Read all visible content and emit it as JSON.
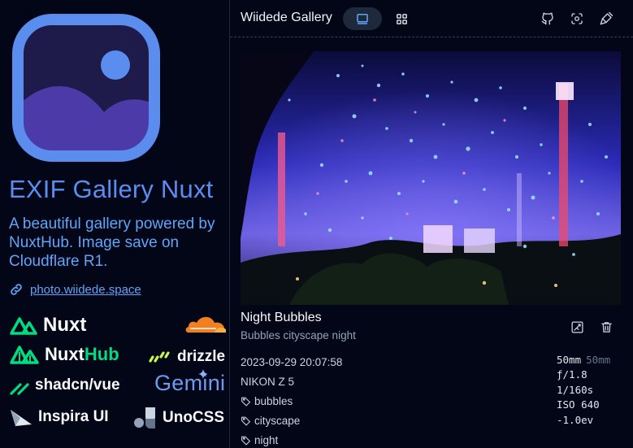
{
  "sidebar": {
    "app_title": "EXIF Gallery Nuxt",
    "description": "A beautiful gallery powered by NuxtHub. Image save on Cloudflare R1.",
    "link_text": "photo.wiidede.space",
    "logos": {
      "nuxt": "Nuxt",
      "nuxthub_a": "Nuxt",
      "nuxthub_b": "Hub",
      "drizzle": "drizzle",
      "shadcn": "shadcn/vue",
      "gemini": "Gemini",
      "inspira": "Inspira UI",
      "unocss": "UnoCSS"
    }
  },
  "header": {
    "title": "Wiidede Gallery"
  },
  "photo": {
    "title": "Night Bubbles",
    "subtitle": "Bubbles cityscape night",
    "date": "2023-09-29 20:07:58",
    "camera": "NIKON Z 5",
    "tags": [
      "bubbles",
      "cityscape",
      "night"
    ],
    "exif": {
      "focal": "50mm",
      "focal_35": "50mm",
      "aperture": "ƒ/1.8",
      "shutter": "1/160s",
      "iso": "ISO 640",
      "ev": "-1.0ev"
    }
  },
  "colors": {
    "background": "#020617",
    "accent": "#60a5fa",
    "nuxt_green": "#00dc82",
    "cloudflare_orange": "#f38020"
  }
}
